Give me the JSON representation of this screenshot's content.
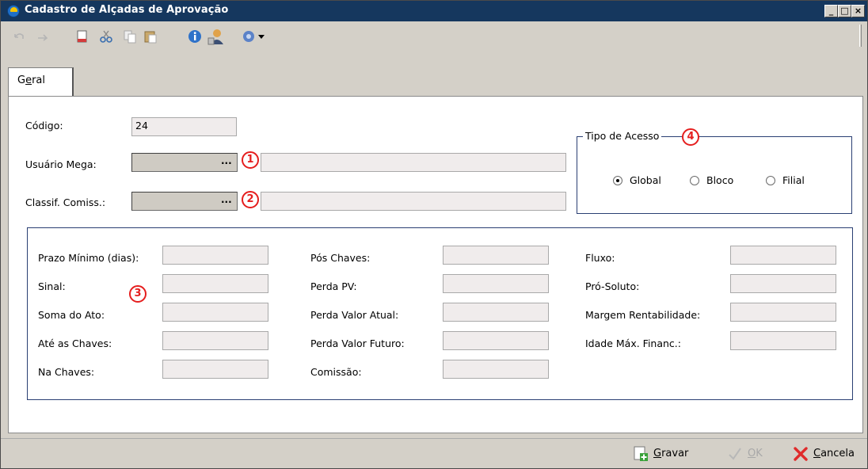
{
  "window": {
    "title": "Cadastro de Alçadas de Aprovação",
    "controls": {
      "minimize": "_",
      "maximize": "□",
      "close": "×"
    }
  },
  "toolbar": {
    "icons": [
      "undo-icon",
      "redo-icon",
      "new-document-icon",
      "cut-icon",
      "copy-icon",
      "paste-icon",
      "info-icon",
      "user-icon",
      "help-icon",
      "dropdown-arrow-icon"
    ]
  },
  "tabs": [
    {
      "label_pre": "G",
      "label_underline": "e",
      "label_post": "ral",
      "active": true
    }
  ],
  "form": {
    "codigo_label": "Código:",
    "codigo_value": "24",
    "usuario_label": "Usuário Mega:",
    "usuario_value": "",
    "usuario_button": "...",
    "classif_label": "Classif. Comiss.:",
    "classif_value": "",
    "classif_button": "..."
  },
  "tipo_acesso": {
    "legend": "Tipo de Acesso",
    "options": [
      {
        "label": "Global",
        "checked": true
      },
      {
        "label": "Bloco",
        "checked": false
      },
      {
        "label": "Filial",
        "checked": false
      }
    ]
  },
  "markers": [
    "1",
    "2",
    "3",
    "4"
  ],
  "fields": {
    "col1": [
      {
        "label": "Prazo Mínimo (dias):",
        "value": ""
      },
      {
        "label": "Sinal:",
        "value": ""
      },
      {
        "label": "Soma do Ato:",
        "value": ""
      },
      {
        "label": "Até as Chaves:",
        "value": ""
      },
      {
        "label": "Na Chaves:",
        "value": ""
      }
    ],
    "col2": [
      {
        "label": "Pós Chaves:",
        "value": ""
      },
      {
        "label": "Perda PV:",
        "value": ""
      },
      {
        "label": "Perda Valor Atual:",
        "value": ""
      },
      {
        "label": "Perda Valor Futuro:",
        "value": ""
      },
      {
        "label": "Comissão:",
        "value": ""
      }
    ],
    "col3": [
      {
        "label": "Fluxo:",
        "value": ""
      },
      {
        "label": "Pró-Soluto:",
        "value": ""
      },
      {
        "label": "Margem Rentabilidade:",
        "value": ""
      },
      {
        "label": "Idade Máx. Financ.:",
        "value": ""
      }
    ]
  },
  "buttons": {
    "gravar_pre": "",
    "gravar_u": "G",
    "gravar_post": "ravar",
    "ok_pre": "",
    "ok_u": "O",
    "ok_post": "K",
    "cancela_pre": "",
    "cancela_u": "C",
    "cancela_post": "ancela"
  },
  "colors": {
    "titlebar": "#15375e",
    "groupbox_border": "#2a3f73",
    "marker": "#e51e1e",
    "field_bg": "#f0ecec"
  }
}
